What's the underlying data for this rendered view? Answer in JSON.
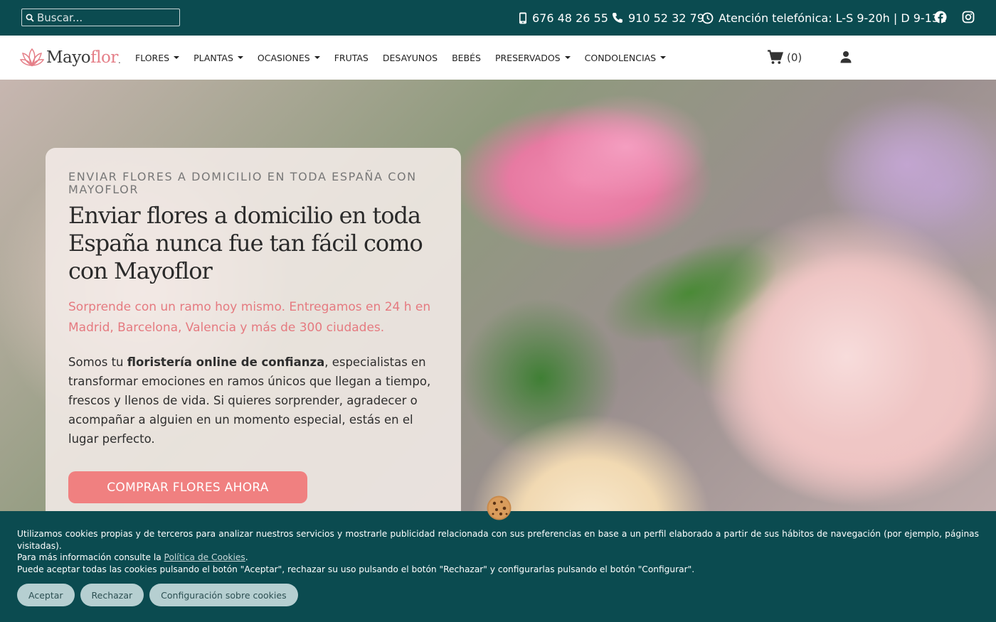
{
  "colors": {
    "topbar": "#0b4b50",
    "accent": "#f08080",
    "lead": "#e57a80"
  },
  "topbar": {
    "search_placeholder": "Buscar...",
    "mobile_phone": "676 48 26 55",
    "landline_phone": "910 52 32 79",
    "hours": "Atención telefónica: L-S 9-20h | D 9-13h",
    "social_icons": [
      "facebook-icon",
      "instagram-icon"
    ]
  },
  "nav": {
    "logo_main": "Mayo",
    "logo_accent": "flor",
    "logo_dot": ".",
    "items": [
      {
        "label": "FLORES",
        "dropdown": true
      },
      {
        "label": "PLANTAS",
        "dropdown": true
      },
      {
        "label": "OCASIONES",
        "dropdown": true
      },
      {
        "label": "FRUTAS",
        "dropdown": false
      },
      {
        "label": "DESAYUNOS",
        "dropdown": false
      },
      {
        "label": "BEBÉS",
        "dropdown": false
      },
      {
        "label": "PRESERVADOS",
        "dropdown": true
      },
      {
        "label": "CONDOLENCIAS",
        "dropdown": true
      }
    ],
    "cart_count": "(0)"
  },
  "hero": {
    "eyebrow": "ENVIAR FLORES A DOMICILIO EN TODA ESPAÑA CON MAYOFLOR",
    "title": "Enviar flores a domicilio en toda España nunca fue tan fácil como con Mayoflor",
    "lead": "Sorprende con un ramo hoy mismo. Entregamos en 24 h en Madrid, Barcelona, Valencia y más de 300 ciudades.",
    "body_prefix": "Somos tu ",
    "body_bold": "floristería online de confianza",
    "body_suffix": ", especialistas en transformar emociones en ramos únicos que llegan a tiempo, frescos y llenos de vida. Si quieres sorprender, agradecer o acompañar a alguien en un momento especial, estás en el lugar perfecto.",
    "cta": "COMPRAR FLORES AHORA"
  },
  "cookies": {
    "line1": "Utilizamos cookies propias y de terceros para analizar nuestros servicios y mostrarle publicidad relacionada con sus preferencias en base a un perfil elaborado a partir de sus hábitos de navegación (por ejemplo, páginas visitadas).",
    "line2_prefix": "Para más información consulte la ",
    "policy_link": "Política de Cookies",
    "line2_suffix": ".",
    "line3": "Puede aceptar todas las cookies pulsando el botón \"Aceptar\", rechazar su uso pulsando el botón \"Rechazar\" y configurarlas pulsando el botón \"Configurar\".",
    "accept": "Aceptar",
    "reject": "Rechazar",
    "configure": "Configuración sobre cookies"
  }
}
